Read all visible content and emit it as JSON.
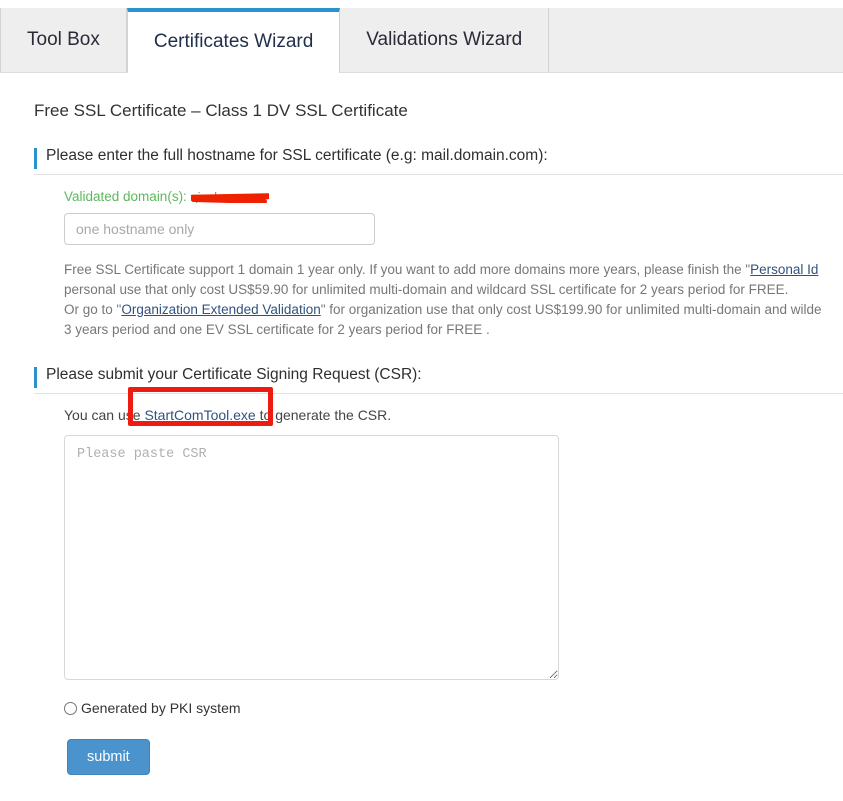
{
  "tabs": [
    {
      "label": "Tool Box",
      "active": false
    },
    {
      "label": "Certificates Wizard",
      "active": true
    },
    {
      "label": "Validations Wizard",
      "active": false
    }
  ],
  "page": {
    "title": "Free SSL Certificate – Class 1 DV SSL Certificate"
  },
  "hostname_section": {
    "heading": "Please enter the full hostname for SSL certificate (e.g: mail.domain.com):",
    "validated_label": "Validated domain(s):",
    "validated_domain_redacted": "qianlue.com",
    "input_placeholder": "one hostname only",
    "input_value": "",
    "info_line1_before": "Free SSL Certificate support 1 domain 1 year only. If you want to add more domains more years, please finish the \"",
    "info_line1_link": "Personal Id",
    "info_line2": "personal use that only cost US$59.90 for unlimited multi-domain and wildcard SSL certificate for 2 years period for FREE.",
    "info_line3_before": "Or go to \"",
    "info_line3_link": "Organization Extended Validation",
    "info_line3_after": "\" for organization use that only cost US$199.90 for unlimited multi-domain and wilde",
    "info_line4": "3 years period and one EV SSL certificate for 2 years period for FREE ."
  },
  "csr_section": {
    "heading": "Please submit your Certificate Signing Request (CSR):",
    "note_before": "You can use ",
    "note_link": "StartComTool.exe",
    "note_after": " to generate the CSR.",
    "textarea_placeholder": "Please paste CSR",
    "textarea_value": "",
    "radio_label": "Generated by PKI system",
    "radio_checked": false,
    "submit_label": "submit"
  },
  "annotations": {
    "highlight_color": "#ee1b11",
    "redaction_color": "#ee2200"
  },
  "colors": {
    "accent": "#2a93cf",
    "button": "#4a93cd",
    "success": "#5cb85c",
    "link": "#31527e"
  }
}
